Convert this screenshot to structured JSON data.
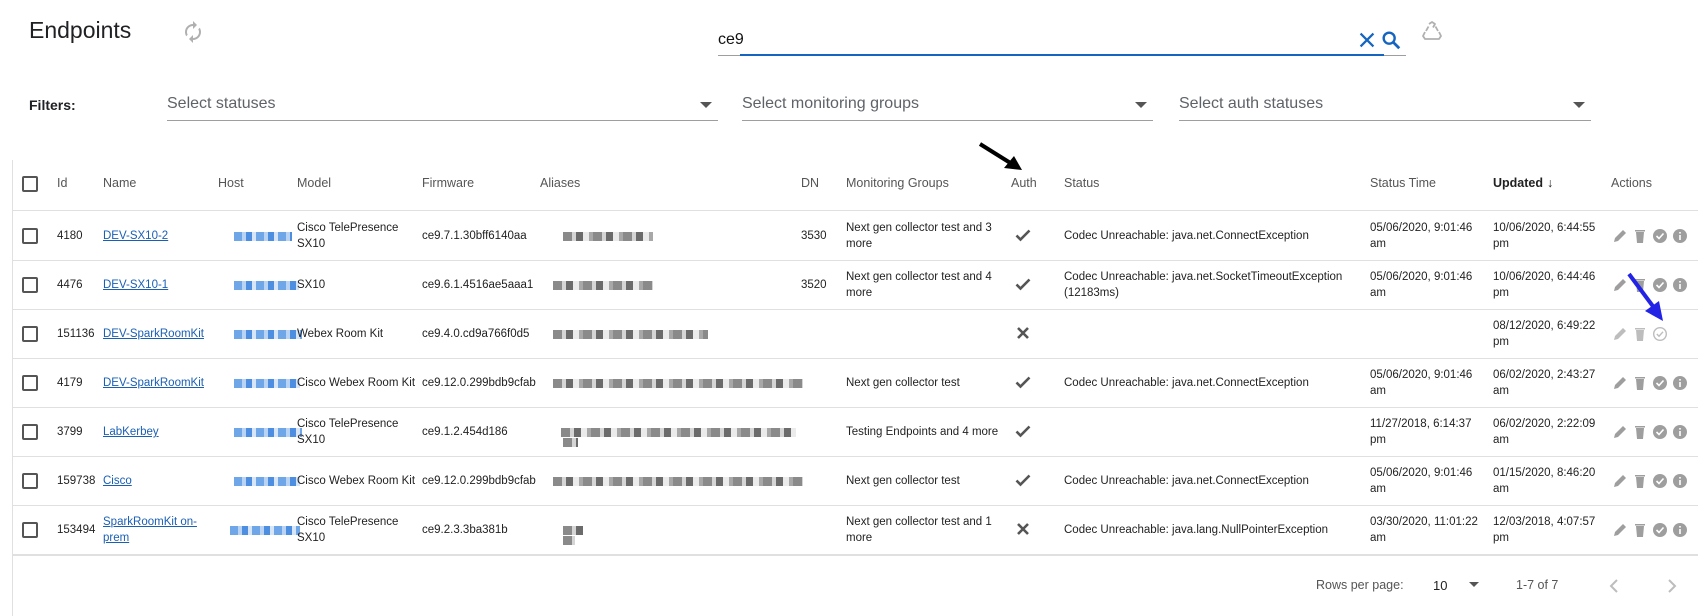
{
  "page": {
    "title": "Endpoints"
  },
  "search": {
    "value": "ce9"
  },
  "filters": {
    "label": "Filters:",
    "statuses_placeholder": "Select statuses",
    "groups_placeholder": "Select monitoring groups",
    "auth_placeholder": "Select auth statuses"
  },
  "table": {
    "columns": {
      "id": "Id",
      "name": "Name",
      "host": "Host",
      "model": "Model",
      "firmware": "Firmware",
      "aliases": "Aliases",
      "dn": "DN",
      "groups": "Monitoring Groups",
      "auth": "Auth",
      "status": "Status",
      "status_time": "Status Time",
      "updated": "Updated",
      "actions": "Actions"
    },
    "sort_arrow": "↓",
    "rows": [
      {
        "id": "4180",
        "name": "DEV-SX10-2",
        "model": "Cisco TelePresence SX10",
        "firmware": "ce9.7.1.30bff6140aa",
        "dn": "3530",
        "groups": "Next gen collector test and 3 more",
        "auth": "check",
        "status": "Codec Unreachable: java.net.ConnectException",
        "status_time": "05/06/2020, 9:01:46 am",
        "updated": "10/06/2020, 6:44:55 pm",
        "action_state": "active"
      },
      {
        "id": "4476",
        "name": "DEV-SX10-1",
        "model": "SX10",
        "firmware": "ce9.6.1.4516ae5aaa1",
        "dn": "3520",
        "groups": "Next gen collector test and 4 more",
        "auth": "check",
        "status": "Codec Unreachable: java.net.SocketTimeoutException (12183ms)",
        "status_time": "05/06/2020, 9:01:46 am",
        "updated": "10/06/2020, 6:44:46 pm",
        "action_state": "active"
      },
      {
        "id": "151136",
        "name": "DEV-SparkRoomKit",
        "model": "Webex Room Kit",
        "firmware": "ce9.4.0.cd9a766f0d5",
        "dn": "",
        "groups": "",
        "auth": "cross",
        "status": "",
        "status_time": "",
        "updated": "08/12/2020, 6:49:22 pm",
        "action_state": "inactive"
      },
      {
        "id": "4179",
        "name": "DEV-SparkRoomKit",
        "model": "Cisco Webex Room Kit",
        "firmware": "ce9.12.0.299bdb9cfab",
        "dn": "",
        "groups": "Next gen collector test",
        "auth": "check",
        "status": "Codec Unreachable: java.net.ConnectException",
        "status_time": "05/06/2020, 9:01:46 am",
        "updated": "06/02/2020, 2:43:27 am",
        "action_state": "active"
      },
      {
        "id": "3799",
        "name": "LabKerbey",
        "model": "Cisco TelePresence SX10",
        "firmware": "ce9.1.2.454d186",
        "dn": "",
        "groups": "Testing Endpoints and 4 more",
        "auth": "check",
        "status": "",
        "status_time": "11/27/2018, 6:14:37 pm",
        "updated": "06/02/2020, 2:22:09 am",
        "action_state": "active"
      },
      {
        "id": "159738",
        "name": "Cisco",
        "model": "Cisco Webex Room Kit",
        "firmware": "ce9.12.0.299bdb9cfab",
        "dn": "",
        "groups": "Next gen collector test",
        "auth": "check",
        "status": "Codec Unreachable: java.net.ConnectException",
        "status_time": "05/06/2020, 9:01:46 am",
        "updated": "01/15/2020, 8:46:20 am",
        "action_state": "active"
      },
      {
        "id": "153494",
        "name": "SparkRoomKit on-prem",
        "model": "Cisco TelePresence SX10",
        "firmware": "ce9.2.3.3ba381b",
        "dn": "",
        "groups": "Next gen collector test and 1 more",
        "auth": "cross",
        "status": "Codec Unreachable: java.lang.NullPointerException",
        "status_time": "03/30/2020, 11:01:22 am",
        "updated": "12/03/2018, 4:07:57 pm",
        "action_state": "active"
      }
    ]
  },
  "pagination": {
    "rows_per_page_label": "Rows per page:",
    "rows_per_page": "10",
    "range": "1-7 of 7"
  },
  "colors": {
    "link": "#1a5fb4",
    "search_accent": "#1565c0",
    "annotation_arrow_blue": "#2323e6",
    "annotation_arrow_black": "#000000"
  },
  "icons": {
    "refresh": "refresh-icon",
    "clear": "close-icon",
    "search": "search-icon",
    "recycle": "recycle-icon",
    "auth_ok": "check-icon",
    "auth_fail": "cross-icon",
    "actions": [
      "edit-icon",
      "delete-icon",
      "check-circle-icon",
      "info-icon"
    ]
  }
}
